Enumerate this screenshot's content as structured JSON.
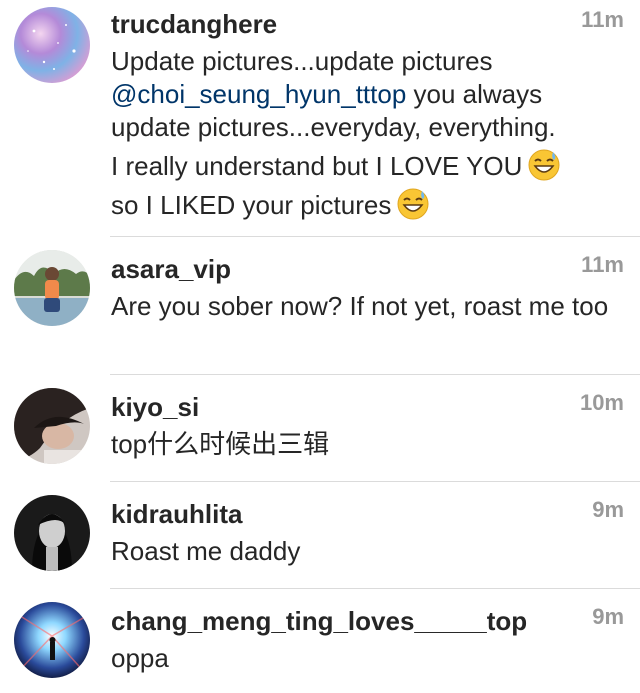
{
  "comments": [
    {
      "username": "trucdanghere",
      "time": "11m",
      "text": {
        "line1": "Update pictures...update pictures",
        "mention": "@choi_seung_hyun_tttop",
        "line2_rest": " you always",
        "line3": "update pictures...everyday, everything.",
        "line4": "I really understand but I LOVE YOU",
        "line5": "so I LIKED your pictures"
      }
    },
    {
      "username": "asara_vip",
      "time": "11m",
      "text": "Are you sober now? If not yet, roast me too"
    },
    {
      "username": "kiyo_si",
      "time": "10m",
      "text": "top什么时候出三辑"
    },
    {
      "username": "kidrauhlita",
      "time": "9m",
      "text": "Roast me daddy"
    },
    {
      "username": "chang_meng_ting_loves_____top",
      "time": "9m",
      "text": "oppa"
    }
  ]
}
